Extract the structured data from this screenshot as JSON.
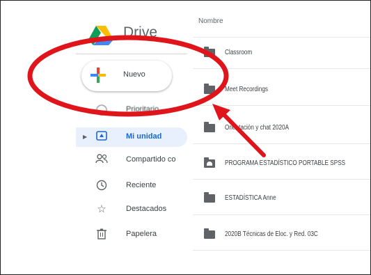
{
  "app": {
    "title": "Drive"
  },
  "new_button": {
    "label": "Nuevo"
  },
  "sidebar": {
    "items": [
      {
        "label": "Prioritario",
        "icon": "priority-icon"
      },
      {
        "label": "Mi unidad",
        "icon": "my-drive-icon",
        "active": true
      },
      {
        "label": "Compartido co",
        "icon": "shared-icon"
      },
      {
        "label": "Reciente",
        "icon": "clock-icon"
      },
      {
        "label": "Destacados",
        "icon": "star-icon"
      },
      {
        "label": "Papelera",
        "icon": "trash-icon"
      }
    ]
  },
  "list": {
    "column_header": "Nombre",
    "rows": [
      {
        "name": "Classroom"
      },
      {
        "name": "Meet Recordings"
      },
      {
        "name": "Orientación y chat 2020A"
      },
      {
        "name": "PROGRAMA ESTADÍSTICO PORTABLE SPSS"
      },
      {
        "name": "ESTADÍSTICA Anne"
      },
      {
        "name": "2020B Técnicas de Eloc. y Red. 03C"
      }
    ]
  },
  "colors": {
    "annotation_red": "#e0141b",
    "active_blue": "#1967d2",
    "active_bg": "#e8f0fe"
  }
}
